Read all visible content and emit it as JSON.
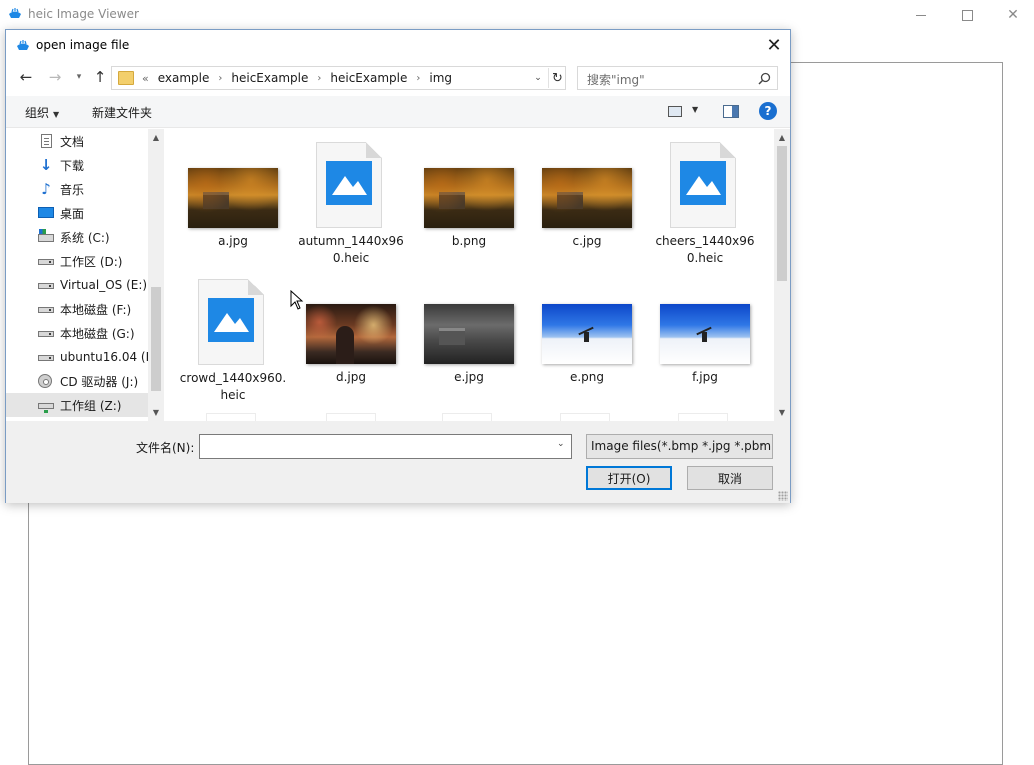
{
  "app": {
    "title": "heic Image Viewer"
  },
  "dialog": {
    "title": "open image file",
    "breadcrumbs": [
      "example",
      "heicExample",
      "heicExample",
      "img"
    ],
    "overflow": "«",
    "search_placeholder": "搜索\"img\"",
    "toolbar": {
      "organize_label": "组织",
      "new_folder_label": "新建文件夹",
      "help_label": "?"
    },
    "nav_items": [
      {
        "label": "文档",
        "icon": "documents-icon"
      },
      {
        "label": "下载",
        "icon": "downloads-icon"
      },
      {
        "label": "音乐",
        "icon": "music-icon"
      },
      {
        "label": "桌面",
        "icon": "desktop-icon"
      },
      {
        "label": "系统 (C:)",
        "icon": "system-drive-icon"
      },
      {
        "label": "工作区 (D:)",
        "icon": "drive-icon"
      },
      {
        "label": "Virtual_OS (E:)",
        "icon": "drive-icon"
      },
      {
        "label": "本地磁盘 (F:)",
        "icon": "drive-icon"
      },
      {
        "label": "本地磁盘 (G:)",
        "icon": "drive-icon"
      },
      {
        "label": "ubuntu16.04 (H",
        "icon": "drive-icon"
      },
      {
        "label": "CD 驱动器 (J:)",
        "icon": "cd-drive-icon"
      },
      {
        "label": "工作组 (Z:)",
        "icon": "network-drive-icon",
        "selected": true
      }
    ],
    "files": [
      {
        "name": "a.jpg",
        "kind": "autumn"
      },
      {
        "name": "autumn_1440x960.heic",
        "kind": "generic"
      },
      {
        "name": "b.png",
        "kind": "autumn"
      },
      {
        "name": "c.jpg",
        "kind": "autumn"
      },
      {
        "name": "cheers_1440x960.heic",
        "kind": "generic"
      },
      {
        "name": "crowd_1440x960.heic",
        "kind": "generic"
      },
      {
        "name": "d.jpg",
        "kind": "city"
      },
      {
        "name": "e.jpg",
        "kind": "gray"
      },
      {
        "name": "e.png",
        "kind": "snow"
      },
      {
        "name": "f.jpg",
        "kind": "snow"
      }
    ],
    "filename_label": "文件名(N):",
    "filename_value": "",
    "filter_selected": "Image files(*.bmp *.jpg *.pbm",
    "open_label": "打开(O)",
    "cancel_label": "取消"
  },
  "colors": {
    "accent": "#0078d7",
    "icon_blue": "#1e88e5",
    "bottom_bar": "#f0f0f0"
  }
}
